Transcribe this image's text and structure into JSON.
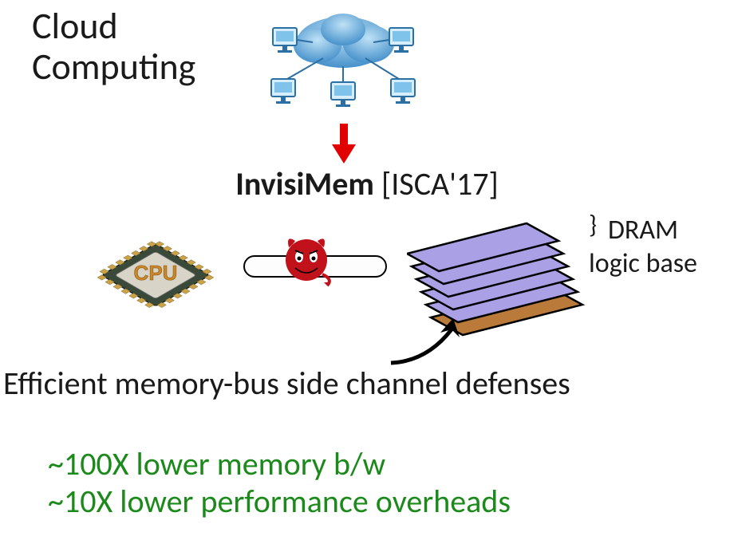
{
  "header": {
    "title_line1": "Cloud",
    "title_line2": "Computing"
  },
  "center": {
    "name_bold": "InvisiMem",
    "citation": " [ISCA'17]"
  },
  "labels": {
    "dram": "DRAM",
    "logic_base": "logic base",
    "defenses": "Efficient memory-bus side channel defenses"
  },
  "benefits": {
    "line1": "~100X lower memory b/w",
    "line2": "~10X lower performance overheads"
  },
  "icons": {
    "cloud": "cloud-computing-icon",
    "cpu": "cpu-chip-icon",
    "devil": "devil-attacker-icon",
    "memory_stack": "stacked-memory-icon",
    "arrow_down": "red-down-arrow-icon",
    "arrow_curve": "curved-arrow-icon"
  },
  "colors": {
    "accent_green": "#1b8a1b",
    "arrow_red": "#e00000",
    "cloud_blue": "#5aa8e0",
    "dram_fill": "#a9a0e5",
    "logic_fill": "#b97a3a"
  }
}
